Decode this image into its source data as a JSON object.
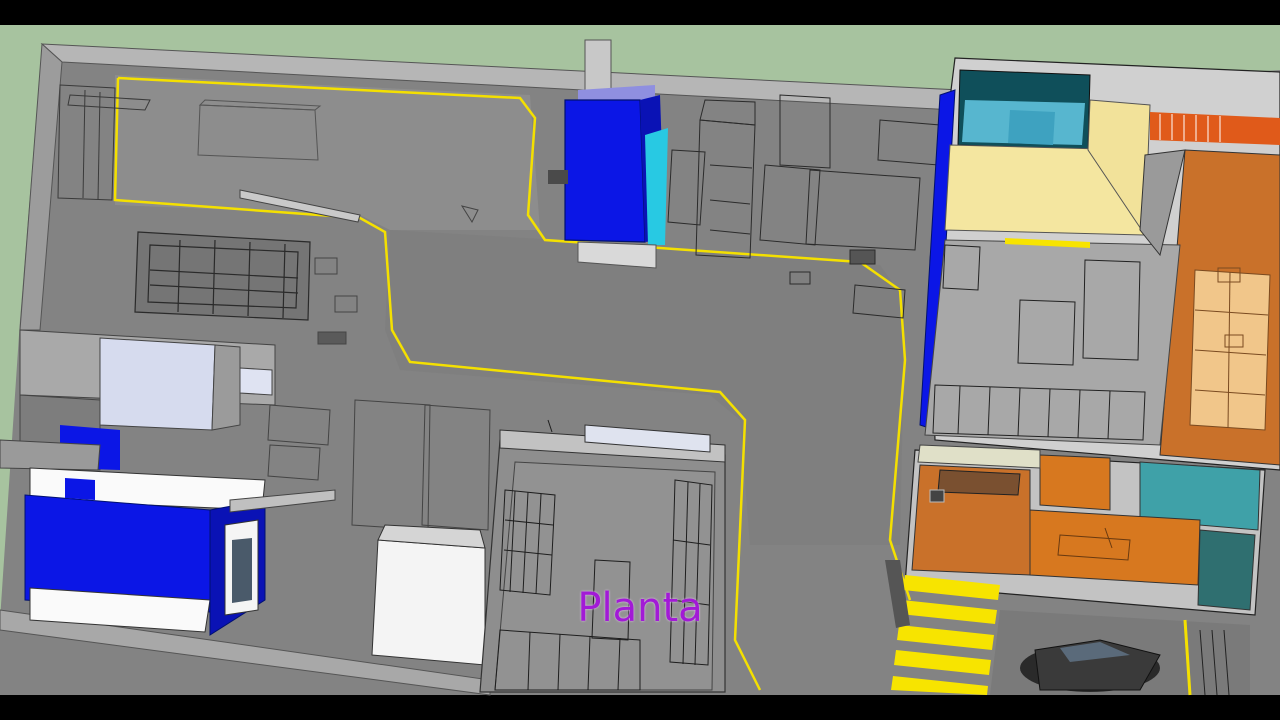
{
  "video": {
    "caption": "Planta"
  },
  "colors": {
    "letterbox": "#000000",
    "ground": "#a7c39f",
    "floor": "#848484",
    "wall_top": "#b9b9b9",
    "wall_side": "#6e6e6e",
    "path_line": "#f4e000",
    "machine_blue": "#0b16e6",
    "accent_cyan": "#28c9e3",
    "cream": "#f4e6a0",
    "orange": "#d7781f",
    "caption": "#a21ad6",
    "crosswalk": "#f7e400"
  }
}
